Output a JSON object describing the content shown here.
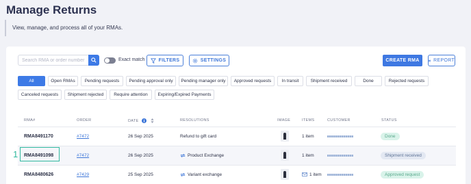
{
  "header": {
    "title": "Manage Returns",
    "subtitle": "View, manage, and process all of your RMAs."
  },
  "toolbar": {
    "search_placeholder": "Search RMA or order number",
    "exact_match_label": "Exact match",
    "filters_label": "FILTERS",
    "settings_label": "SETTINGS",
    "create_label": "CREATE RMA",
    "report_label": "REPORT"
  },
  "filters": [
    "All",
    "Open RMAs",
    "Pending requests",
    "Pending approval only",
    "Pending manager only",
    "Approved requests",
    "In transit",
    "Shipment received",
    "Done",
    "Rejected requests",
    "Canceled requests",
    "Shipment rejected",
    "Require attention",
    "Expiring/Expired Payments"
  ],
  "table": {
    "headers": [
      "RMA#",
      "ORDER",
      "DATE",
      "RESOLUTIONS",
      "IMAGE",
      "ITEMS",
      "CUSTOMER",
      "STATUS"
    ],
    "rows": [
      {
        "rma": "RMA8491170",
        "order": "#7472",
        "date": "26 Sep 2025",
        "resolution": "Refund to gift card",
        "items": "1 item",
        "status": "Done"
      },
      {
        "rma": "RMA8491098",
        "order": "#7472",
        "date": "26 Sep 2025",
        "resolution": "Product Exchange",
        "items": "1 item",
        "status": "Shipment received"
      },
      {
        "rma": "RMA8480626",
        "order": "#7429",
        "date": "25 Sep 2025",
        "resolution": "Variant exchange",
        "items": "1 item",
        "status": "Approved request"
      }
    ]
  },
  "annotation": "1",
  "colors": {
    "accent": "#3d7ae6",
    "highlight": "#30b89e"
  }
}
